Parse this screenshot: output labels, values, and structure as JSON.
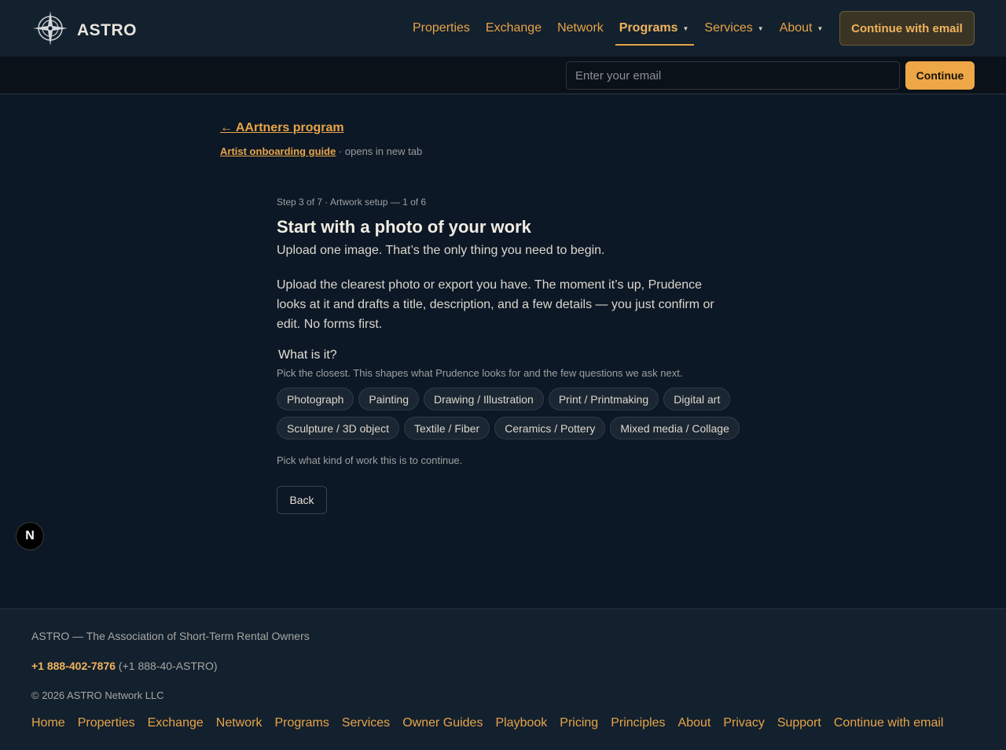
{
  "header": {
    "brand": "ASTRO",
    "nav": [
      {
        "label": "Properties"
      },
      {
        "label": "Exchange"
      },
      {
        "label": "Network"
      },
      {
        "label": "Programs"
      },
      {
        "label": "Services"
      },
      {
        "label": "About"
      }
    ],
    "cta": "Continue with email"
  },
  "email_strip": {
    "placeholder": "Enter your email",
    "button": "Continue"
  },
  "main": {
    "back_link": "← AArtners program",
    "guide_link": "Artist onboarding guide",
    "guide_note": " · opens in new tab",
    "step": "Step 3 of 7 · Artwork setup — 1 of 6",
    "heading": "Start with a photo of your work",
    "subheading": "Upload one image. That’s the only thing you need to begin.",
    "paragraph": "Upload the clearest photo or export you have. The moment it’s up, Prudence looks at it and drafts a title, description, and a few details — you just confirm or edit. No forms first.",
    "question": "What is it?",
    "question_help": "Pick the closest. This shapes what Prudence looks for and the few questions we ask next.",
    "chips_row1": [
      "Photograph",
      "Painting",
      "Drawing / Illustration",
      "Print / Printmaking",
      "Digital art"
    ],
    "chips_row2": [
      "Sculpture / 3D object",
      "Textile / Fiber",
      "Ceramics / Pottery",
      "Mixed media / Collage"
    ],
    "hint": "Pick what kind of work this is to continue.",
    "back_button": "Back"
  },
  "badge": "N",
  "footer": {
    "org": "ASTRO — The Association of Short-Term Rental Owners",
    "phone": "+1 888-402-7876",
    "phone_alt": " (+1 888-40-ASTRO)",
    "copyright": "© 2026 ASTRO Network LLC",
    "links": [
      "Home",
      "Properties",
      "Exchange",
      "Network",
      "Programs",
      "Services",
      "Owner Guides",
      "Playbook",
      "Pricing",
      "Principles",
      "About",
      "Privacy",
      "Support",
      "Continue with email"
    ]
  },
  "colors": {
    "accent": "#e7a447",
    "background": "#0c1826",
    "header_bg": "#13202e"
  }
}
